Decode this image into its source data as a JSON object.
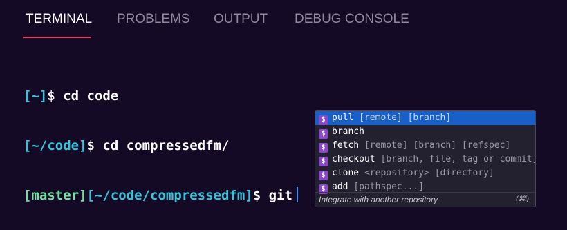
{
  "panel": {
    "tabs": [
      {
        "label": "TERMINAL",
        "active": true
      },
      {
        "label": "PROBLEMS",
        "active": false
      },
      {
        "label": "OUTPUT",
        "active": false
      },
      {
        "label": "DEBUG CONSOLE",
        "active": false
      }
    ],
    "accent_color": "#e0405a"
  },
  "terminal": {
    "lines": [
      {
        "branch": "",
        "path": "[~]",
        "prompt": "$",
        "command": "cd code"
      },
      {
        "branch": "",
        "path": "[~/code]",
        "prompt": "$",
        "command": "cd compressedfm/"
      },
      {
        "branch": "[master]",
        "path": "[~/code/compressedfm]",
        "prompt": "$",
        "command": "git"
      }
    ],
    "colors": {
      "path": "#33c6da",
      "branch": "#72e0a0",
      "text": "#ffffff"
    }
  },
  "suggestions": {
    "icon": "dollar-sign-icon",
    "icon_glyph": "$",
    "items": [
      {
        "name": "pull",
        "args": "[remote] [branch]",
        "selected": true
      },
      {
        "name": "branch",
        "args": "",
        "selected": false
      },
      {
        "name": "fetch",
        "args": "[remote] [branch] [refspec]",
        "selected": false
      },
      {
        "name": "checkout",
        "args": "[branch, file, tag or commit]",
        "selected": false
      },
      {
        "name": "clone",
        "args": "<repository> [directory]",
        "selected": false
      },
      {
        "name": "add",
        "args": "[pathspec...]",
        "selected": false
      }
    ],
    "description": "Integrate with another repository",
    "shortcut": "(⌘i)"
  }
}
